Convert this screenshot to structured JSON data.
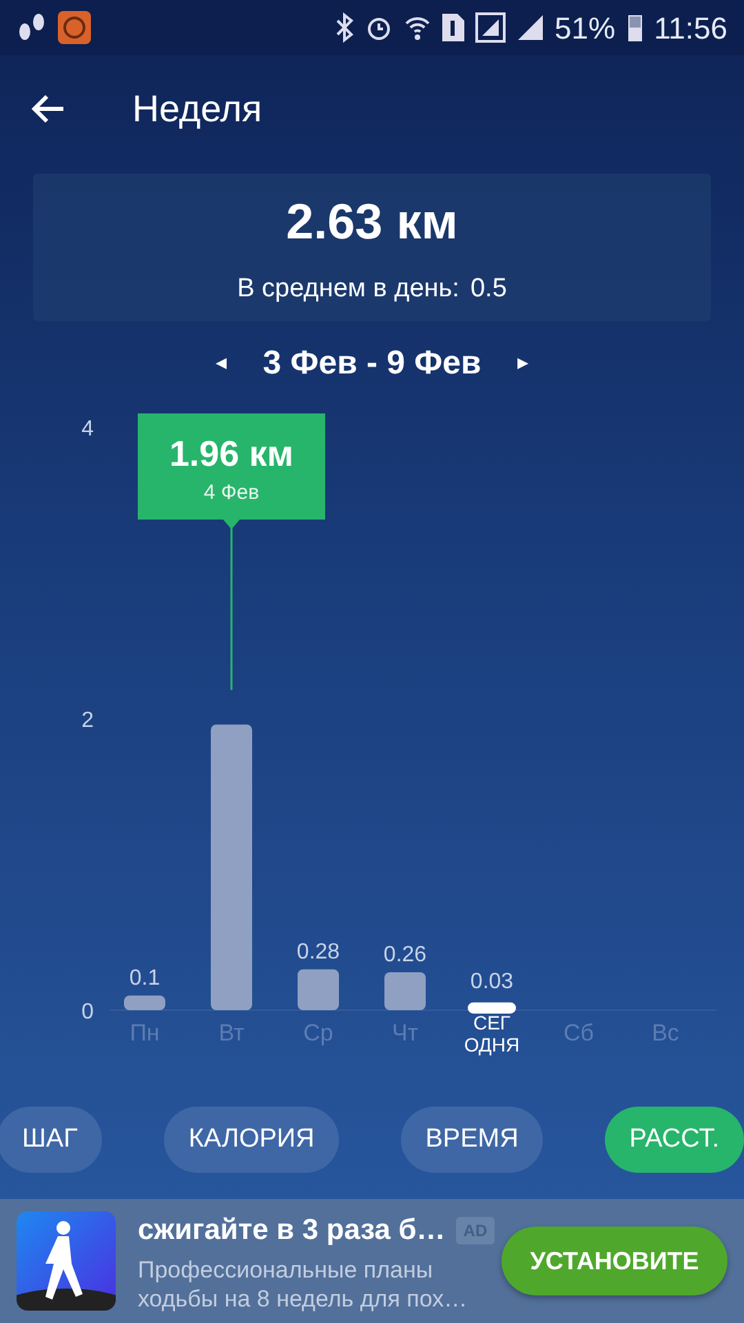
{
  "status_bar": {
    "battery": "51%",
    "time": "11:56"
  },
  "header": {
    "title": "Неделя"
  },
  "summary": {
    "total": "2.63 км",
    "average_label": "В среднем в день:",
    "average_value": "0.5"
  },
  "week_nav": {
    "prev": "◂",
    "range": "3 Фев - 9 Фев",
    "next": "▸"
  },
  "chart": {
    "today": [
      false,
      false,
      false,
      false,
      true,
      false,
      false
    ],
    "tooltip": {
      "value": "1.96 км",
      "date": "4 Фев"
    },
    "chart_data": {
      "type": "bar",
      "categories": [
        "Пн",
        "Вт",
        "Ср",
        "Чт",
        "СЕГ\nОДНЯ",
        "Сб",
        "Вс"
      ],
      "values": [
        0.1,
        1.96,
        0.28,
        0.26,
        0.03,
        null,
        null
      ],
      "value_labels": [
        "0.1",
        null,
        "0.28",
        "0.26",
        "0.03",
        null,
        null
      ],
      "ylim": [
        0,
        4
      ],
      "yticks": [
        0,
        2,
        4
      ]
    }
  },
  "metrics": [
    {
      "label": "ШАГ",
      "selected": false
    },
    {
      "label": "КАЛОРИЯ",
      "selected": false
    },
    {
      "label": "ВРЕМЯ",
      "selected": false
    },
    {
      "label": "РАССТ.",
      "selected": true
    }
  ],
  "ad": {
    "title": "сжигайте в 3 раза б…",
    "badge": "AD",
    "text": "Профессиональные планы ходьбы на 8 недель для пох…",
    "button": "УСТАНОВИТЕ"
  }
}
